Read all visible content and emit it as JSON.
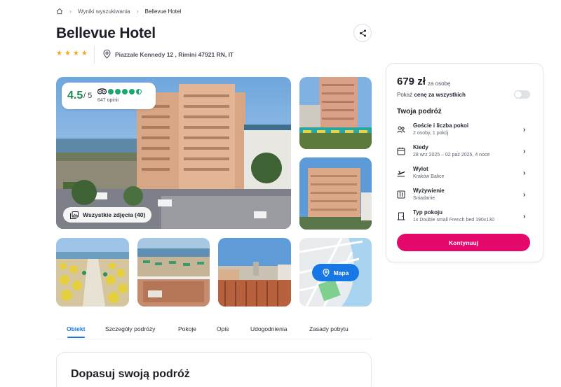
{
  "breadcrumb": {
    "home_icon": "home-icon",
    "items": [
      "Wyniki wyszukiwania",
      "Bellevue Hotel"
    ]
  },
  "hotel": {
    "name": "Bellevue Hotel",
    "stars": 4,
    "address": "Piazzale Kennedy 12 , Rimini 47921 RN, IT"
  },
  "rating": {
    "score": "4.5",
    "scale": "/ 5",
    "reviews": "647 opinii",
    "bubbles": 4.5
  },
  "gallery": {
    "all_photos_label": "Wszystkie zdjęcia (40)",
    "map_label": "Mapa"
  },
  "tabs": [
    "Obiekt",
    "Szczegóły podróży",
    "Pokoje",
    "Opis",
    "Udogodnienia",
    "Zasady pobytu"
  ],
  "section": {
    "title": "Dopasuj swoją podróż"
  },
  "booking": {
    "price": "679 zł",
    "price_unit": "za osobę",
    "total_prefix": "Pokaż ",
    "total_bold": "cenę za wszystkich",
    "total_toggle_on": false,
    "trip_title": "Twoja podróż",
    "rows": [
      {
        "icon": "guests-icon",
        "label": "Goście i liczba pokoi",
        "value": "2 osoby, 1 pokój"
      },
      {
        "icon": "calendar-icon",
        "label": "Kiedy",
        "value": "28 wrz 2025 – 02 paź 2025, 4 noce"
      },
      {
        "icon": "plane-icon",
        "label": "Wylot",
        "value": "Kraków Balice"
      },
      {
        "icon": "meal-icon",
        "label": "Wyżywienie",
        "value": "Śniadanie"
      },
      {
        "icon": "room-icon",
        "label": "Typ pokoju",
        "value": "1x Double small French bed 190x130"
      }
    ],
    "continue_label": "Kontynuuj"
  },
  "colors": {
    "accent": "#1677e5",
    "cta": "#e5096e",
    "rating_green": "#1a8a4f",
    "stars": "#f5a623"
  }
}
